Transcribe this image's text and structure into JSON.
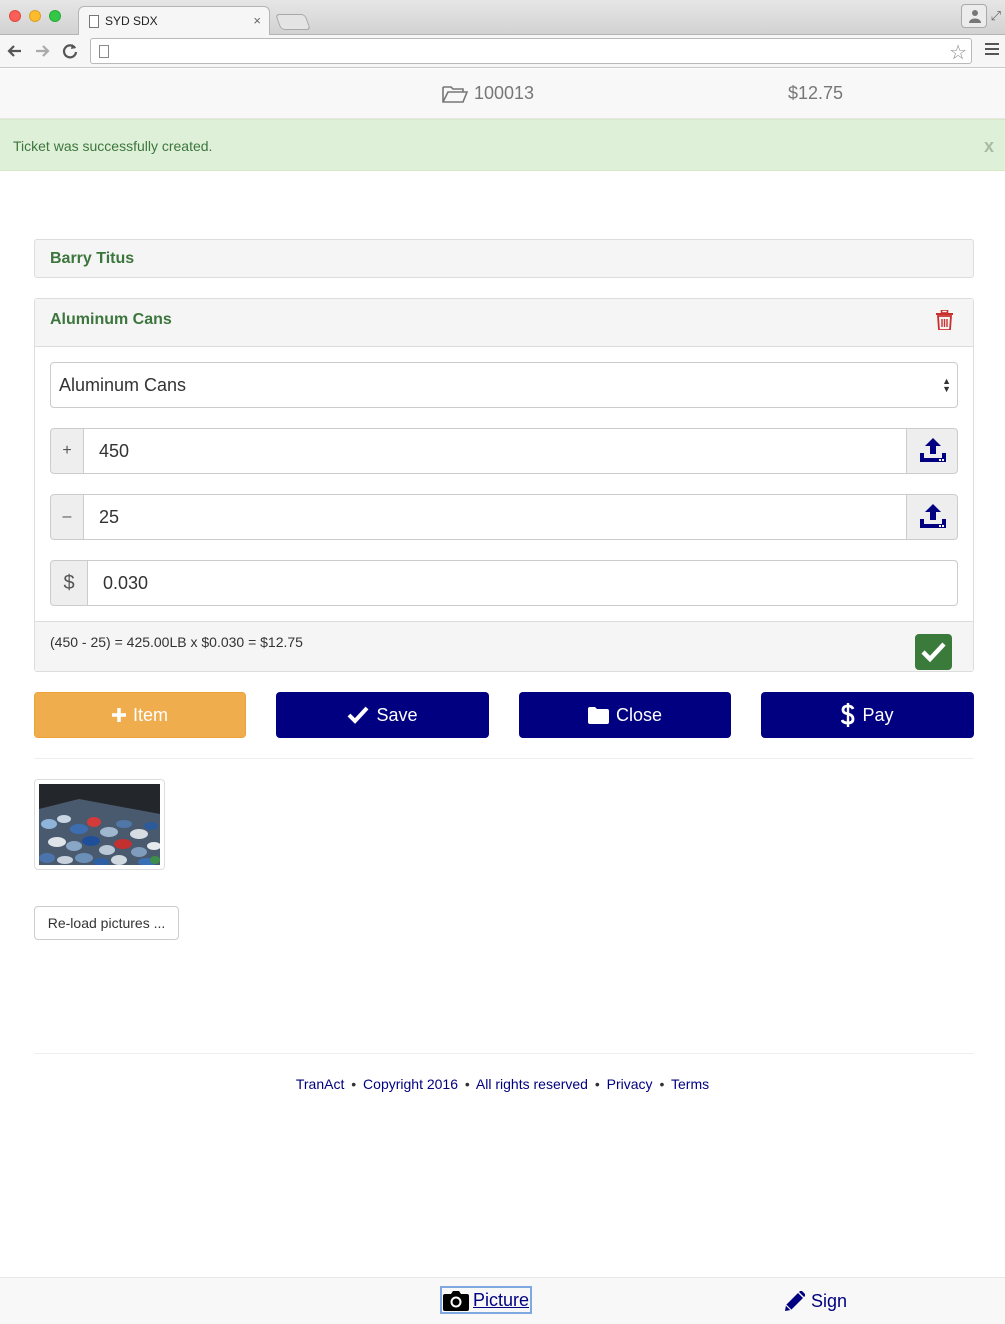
{
  "browser": {
    "tab_title": "SYD SDX",
    "tab_close": "×",
    "resize_glyph": "⤢",
    "star_glyph": "☆"
  },
  "appbar": {
    "ticket_number": "100013",
    "ticket_total": "$12.75"
  },
  "alert": {
    "message": "Ticket was successfully created.",
    "close_label": "x"
  },
  "customer": {
    "name": "Barry Titus"
  },
  "item": {
    "title": "Aluminum Cans",
    "material_select": "Aluminum Cans",
    "gross_prefix": "+",
    "gross_value": "450",
    "tare_prefix": "–",
    "tare_value": "25",
    "price_prefix": "$",
    "price_value": "0.030",
    "calculation": "(450 - 25) = 425.00LB x $0.030 = $12.75"
  },
  "actions": {
    "item_label": "Item",
    "save_label": "Save",
    "close_label": "Close",
    "pay_label": "Pay"
  },
  "pictures": {
    "reload_label": "Re-load pictures ..."
  },
  "footer": {
    "brand": "TranAct",
    "copyright": "Copyright 2016",
    "rights": "All rights reserved",
    "privacy": "Privacy",
    "terms": "Terms",
    "separator": "•"
  },
  "bottom_bar": {
    "picture_label": "Picture",
    "sign_label": "Sign"
  },
  "colors": {
    "primary": "#000080",
    "warning": "#f0ad4e",
    "success_text": "#3c763d",
    "success_bg": "#dff0d8",
    "danger": "#c9302c"
  },
  "icons": [
    "folder-open-icon",
    "trash-icon",
    "upload-icon",
    "check-icon",
    "plus-icon",
    "folder-icon",
    "dollar-icon",
    "camera-icon",
    "pencil-icon"
  ]
}
